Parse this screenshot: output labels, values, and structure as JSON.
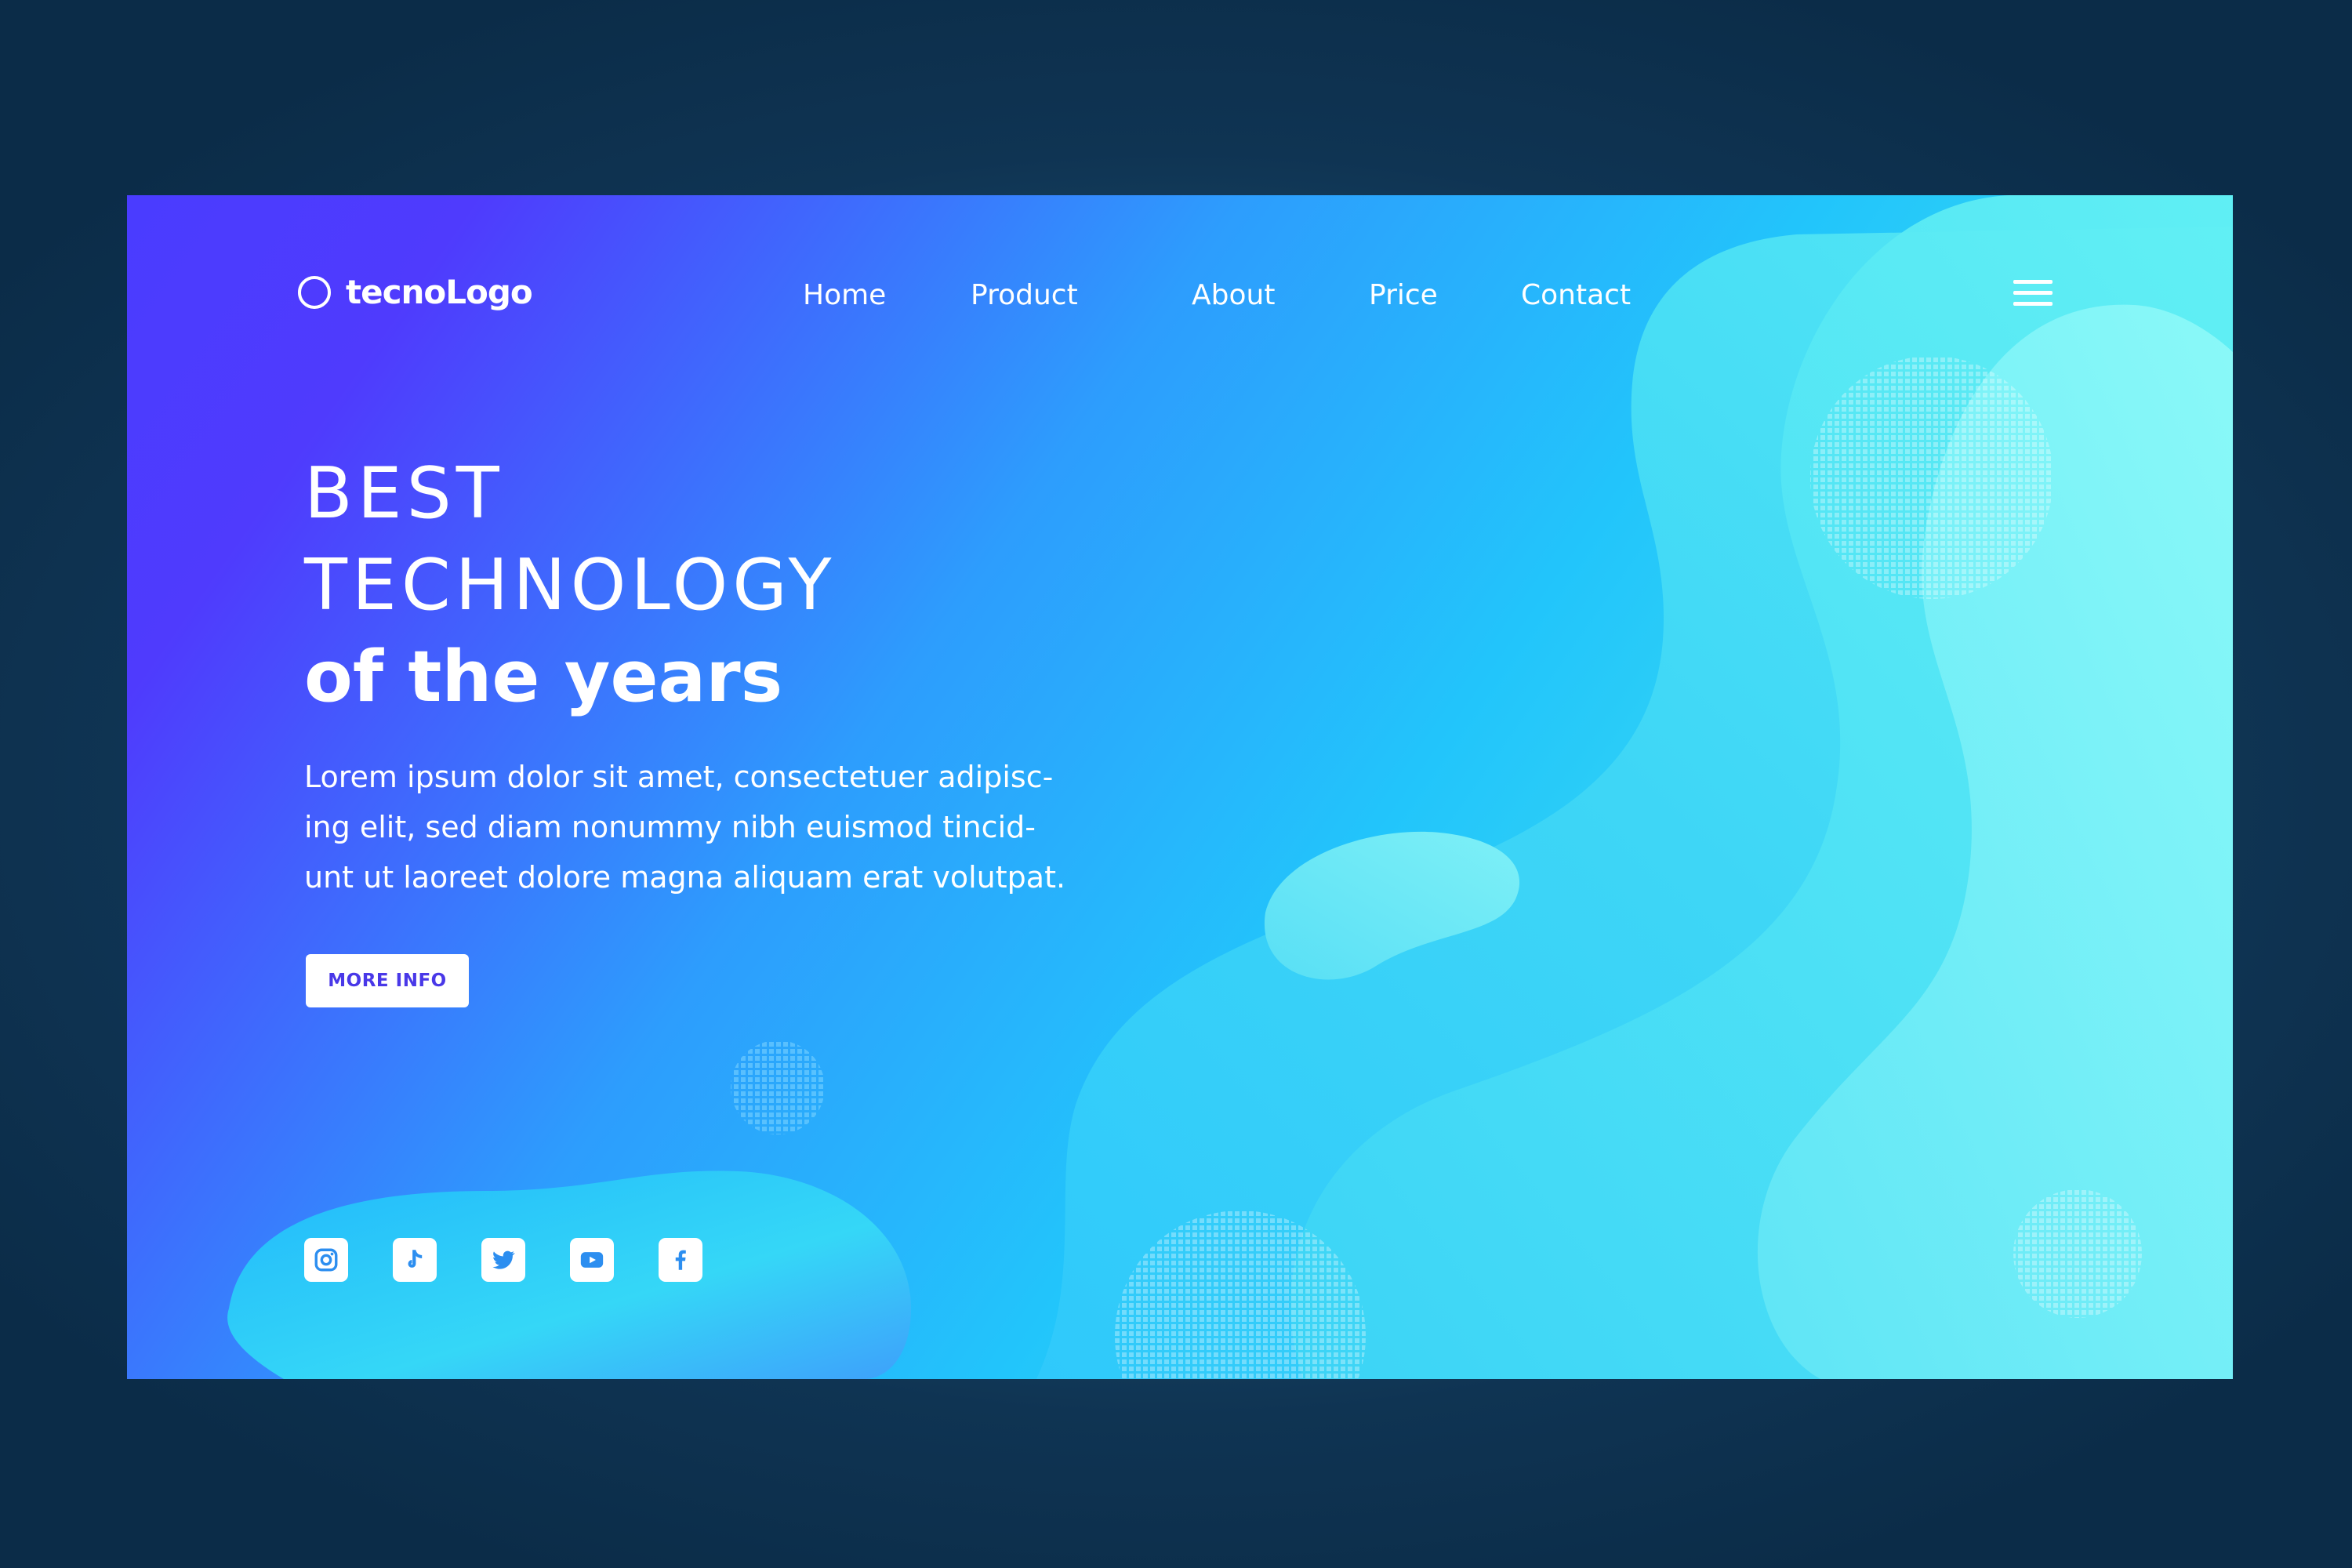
{
  "brand": {
    "logo_text": "tecnoLogo"
  },
  "nav": {
    "items": [
      {
        "label": "Home"
      },
      {
        "label": "Product"
      },
      {
        "label": "About"
      },
      {
        "label": "Price"
      },
      {
        "label": "Contact"
      }
    ]
  },
  "hero": {
    "title_line1": "BEST",
    "title_line2": "TECHNOLOGY",
    "title_line3": "of the years",
    "description_lines": [
      "Lorem ipsum dolor sit amet, consectetuer adipisc-",
      "ing elit, sed diam nonummy nibh euismod tincid-",
      "unt ut laoreet dolore magna aliquam erat volutpat."
    ],
    "cta_label": "MORE INFO"
  },
  "social": [
    {
      "icon": "instagram-icon"
    },
    {
      "icon": "tiktok-icon"
    },
    {
      "icon": "twitter-icon"
    },
    {
      "icon": "youtube-icon"
    },
    {
      "icon": "facebook-icon"
    }
  ],
  "colors": {
    "accent": "#4938e8",
    "gradient_start": "#4a3cff",
    "gradient_mid": "#22c5fb",
    "gradient_end": "#b6f7c9",
    "icon_color": "#2c8ef0"
  }
}
